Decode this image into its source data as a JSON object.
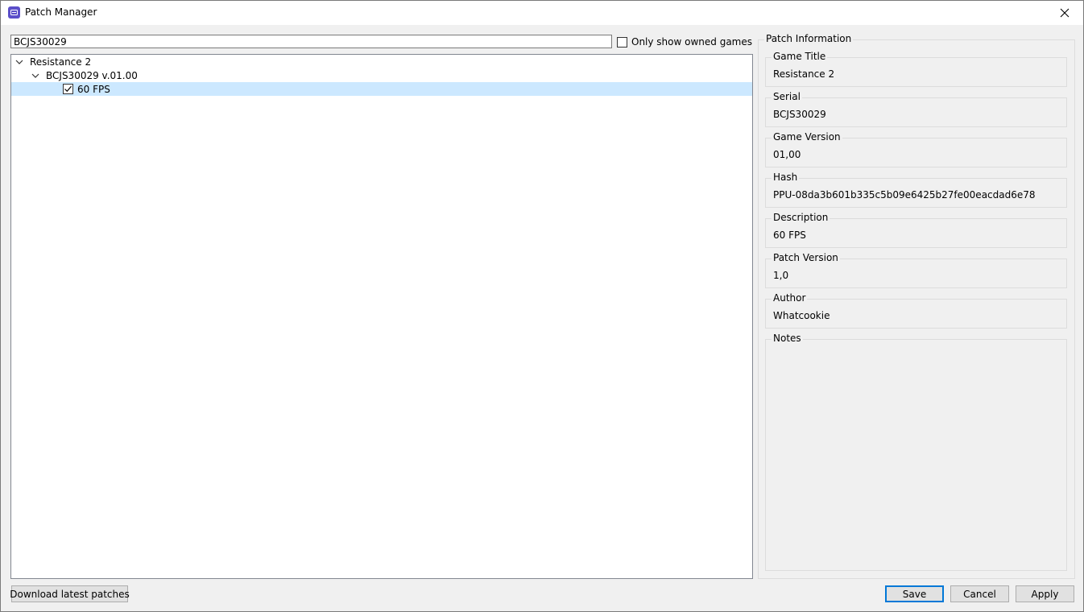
{
  "window": {
    "title": "Patch Manager"
  },
  "search": {
    "value": "BCJS30029",
    "owned_only_label": "Only show owned games",
    "owned_only_checked": false
  },
  "tree": {
    "game": "Resistance 2",
    "version_node": "BCJS30029 v.01.00",
    "patch": "60 FPS",
    "patch_checked": true
  },
  "info": {
    "group_title": "Patch Information",
    "game_title_label": "Game Title",
    "game_title_value": "Resistance 2",
    "serial_label": "Serial",
    "serial_value": "BCJS30029",
    "game_version_label": "Game Version",
    "game_version_value": "01,00",
    "hash_label": "Hash",
    "hash_value": "PPU-08da3b601b335c5b09e6425b27fe00eacdad6e78",
    "description_label": "Description",
    "description_value": "60 FPS",
    "patch_version_label": "Patch Version",
    "patch_version_value": "1,0",
    "author_label": "Author",
    "author_value": "Whatcookie",
    "notes_label": "Notes"
  },
  "buttons": {
    "download": "Download latest patches",
    "save": "Save",
    "cancel": "Cancel",
    "apply": "Apply"
  },
  "colors": {
    "selection": "#cce8ff",
    "accent": "#0078d7",
    "app_icon": "#5b4fc9"
  }
}
